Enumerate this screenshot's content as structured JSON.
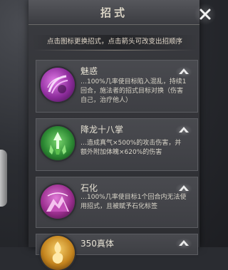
{
  "dialog": {
    "title": "招式",
    "close_label": "✕",
    "hint": "点击图标更换招式，点击箭头可改变出招顺序"
  },
  "skills": [
    {
      "name": "魅惑",
      "description": "…100%几率使目标陷入混乱，持续1回合，施法者的招式目标对换（伤害自己，治疗他人）",
      "icon": "purple-wave-icon",
      "color": "#8d2c9c"
    },
    {
      "name": "降龙十八掌",
      "description": "…造成真气×500%的攻击伤害，并额外附加体魄×620%的伤害",
      "icon": "green-crystal-icon",
      "color": "#2d8a34"
    },
    {
      "name": "石化",
      "description": "…100%几率使目标1个回合内无法使用招式，且被赋予石化标签",
      "icon": "pink-mountain-icon",
      "color": "#9a2e8e"
    },
    {
      "name": "350真体",
      "description": "",
      "icon": "golden-flame-icon",
      "color": "#c4841e"
    }
  ]
}
